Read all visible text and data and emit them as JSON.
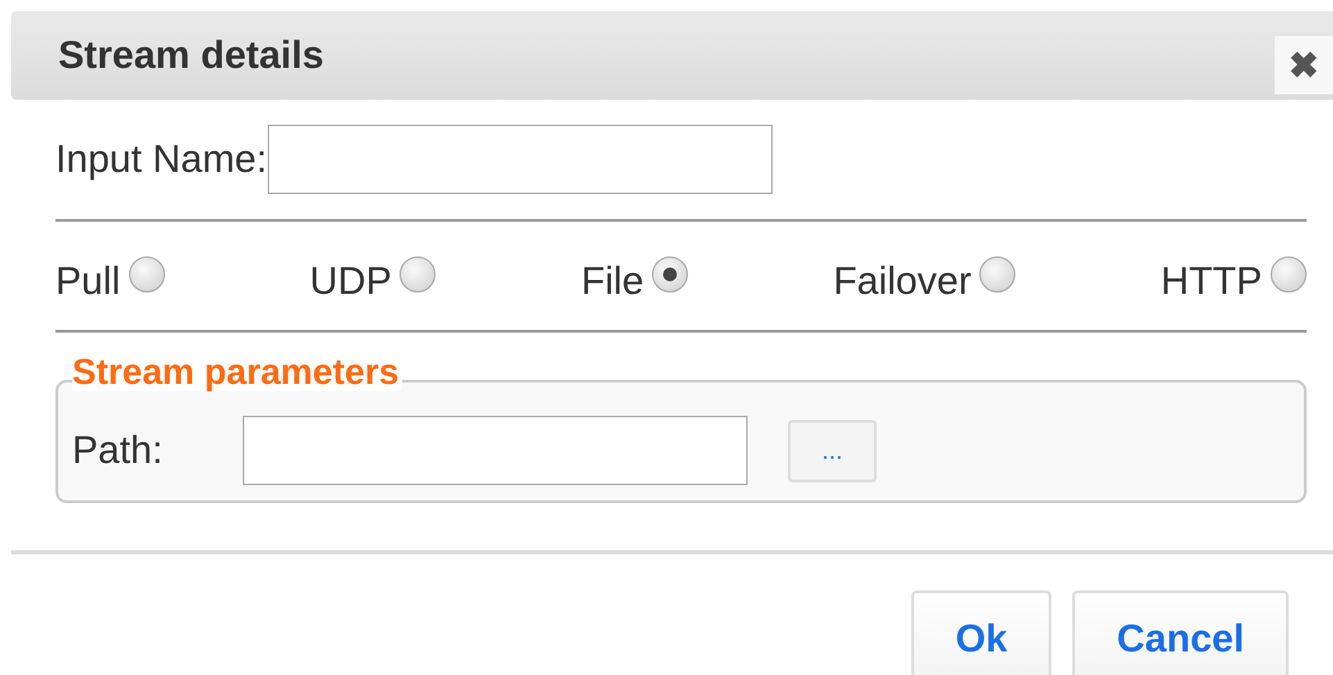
{
  "dialog": {
    "title": "Stream details",
    "close": "✖"
  },
  "input_name": {
    "label": "Input Name:"
  },
  "stream_types": [
    {
      "label": "Pull",
      "selected": false
    },
    {
      "label": "UDP",
      "selected": false
    },
    {
      "label": "File",
      "selected": true
    },
    {
      "label": "Failover",
      "selected": false
    },
    {
      "label": "HTTP",
      "selected": false
    }
  ],
  "stream_parameters": {
    "legend": "Stream parameters",
    "path_label": "Path:",
    "browse": "..."
  },
  "buttons": [
    "Ok",
    "Cancel"
  ]
}
